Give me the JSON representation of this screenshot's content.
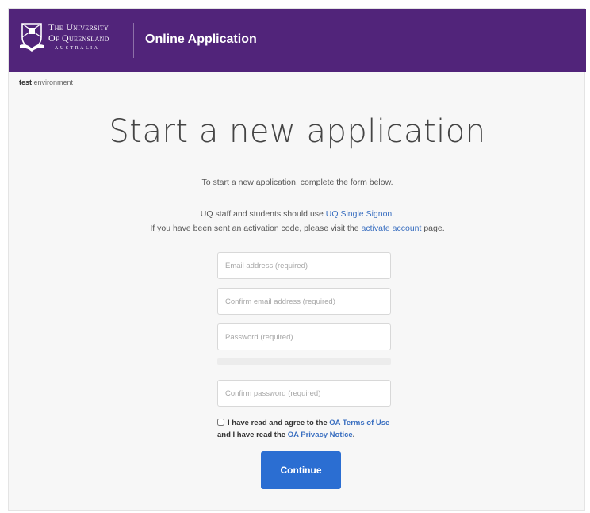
{
  "header": {
    "logo": {
      "line1": "The University",
      "line2": "Of Queensland",
      "line3": "AUSTRALIA"
    },
    "app_title": "Online Application"
  },
  "environment": {
    "name": "test",
    "suffix": " environment"
  },
  "main": {
    "heading": "Start a new application",
    "intro": "To start a new application, complete the form below.",
    "staff_prefix": "UQ staff and students should use ",
    "staff_link": "UQ Single Signon",
    "staff_suffix": ".",
    "activation_prefix": "If you have been sent an activation code, please visit the ",
    "activation_link": "activate account",
    "activation_suffix": " page."
  },
  "form": {
    "email_placeholder": "Email address (required)",
    "confirm_email_placeholder": "Confirm email address (required)",
    "password_placeholder": "Password (required)",
    "confirm_password_placeholder": "Confirm password (required)",
    "terms_prefix": "I have read and agree to the ",
    "terms_link": "OA Terms of Use",
    "terms_middle": " and I have read the ",
    "privacy_link": "OA Privacy Notice",
    "terms_suffix": ".",
    "terms_checked": false,
    "continue_label": "Continue"
  },
  "colors": {
    "header_bg": "#51247a",
    "link": "#3a6fc0",
    "button": "#2b6ed2"
  }
}
